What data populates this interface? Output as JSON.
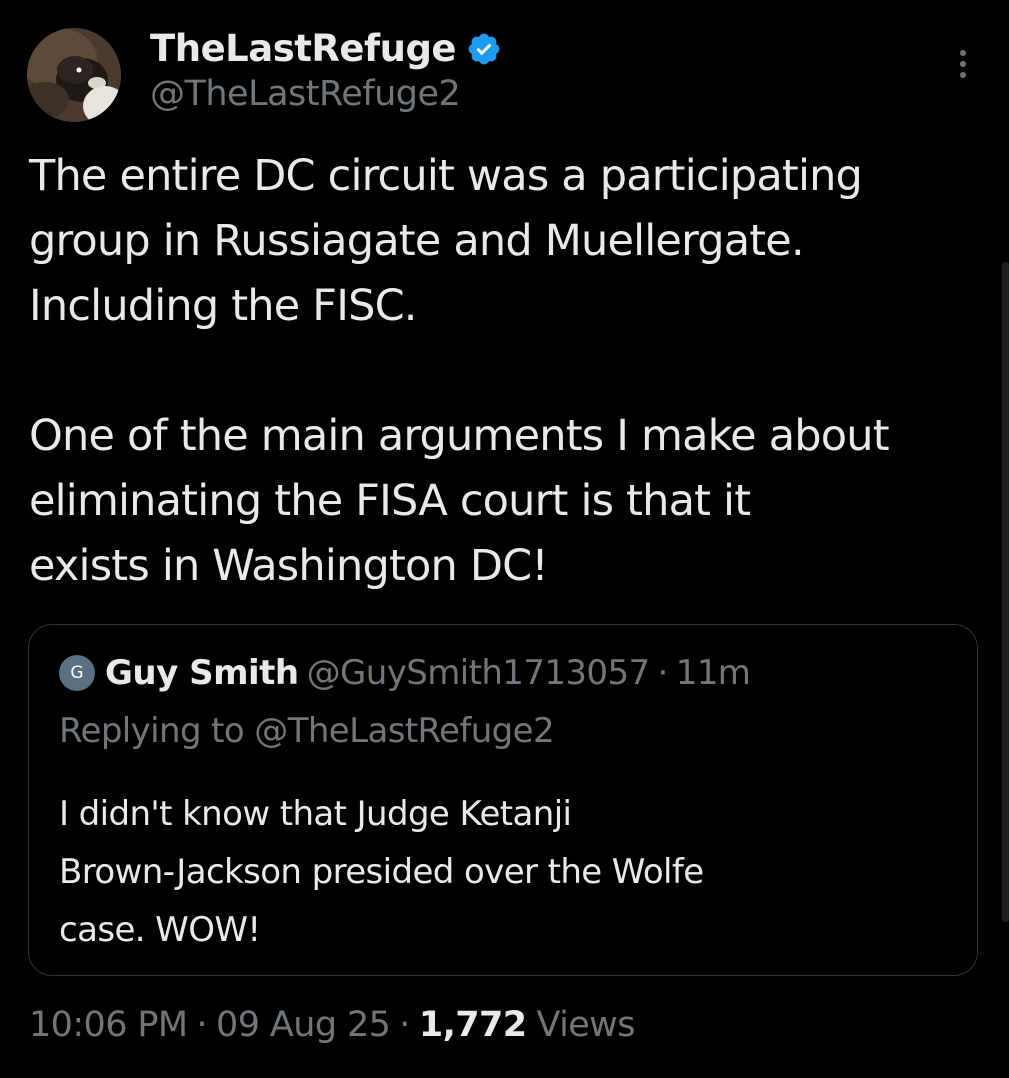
{
  "author": {
    "name": "TheLastRefuge",
    "handle": "@TheLastRefuge2",
    "verified": true,
    "verified_color": "#1d9bf0"
  },
  "tweet": {
    "paragraph_1": "The entire DC circuit was a participating\ngroup in Russiagate and Muellergate.\nIncluding the FISC.",
    "paragraph_2": "One of the main arguments I make about\neliminating the FISA court is that it\nexists in Washington DC!"
  },
  "quoted_tweet": {
    "avatar_letter": "G",
    "name": "Guy Smith",
    "handle": "@GuySmith1713057",
    "separator": "·",
    "time": "11m",
    "replying_to": "Replying to @TheLastRefuge2",
    "text": "I didn't know that Judge Ketanji\nBrown-Jackson presided over the Wolfe\ncase.  WOW!"
  },
  "meta": {
    "time": "10:06 PM",
    "date": "09 Aug 25",
    "separator": "·",
    "views_count": "1,772",
    "views_label": "Views"
  },
  "icons": {
    "verified": "verified-badge-icon",
    "more": "more-vertical-icon"
  },
  "colors": {
    "background": "#000000",
    "text_primary": "#e7e9ea",
    "text_secondary": "#71767b",
    "border": "#2f3336",
    "accent": "#1d9bf0"
  }
}
